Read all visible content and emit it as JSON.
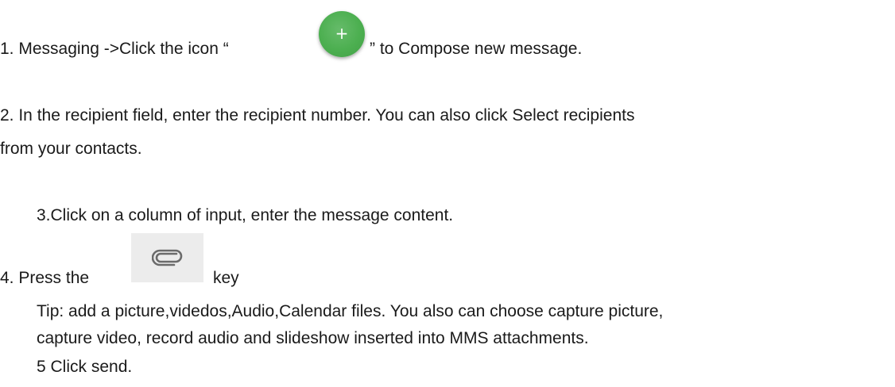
{
  "steps": {
    "step1_before": "1. Messaging ->Click the icon “",
    "step1_icon_glyph": "+",
    "step1_after": "” to Compose new message.",
    "step2_line1": "2. In the recipient field, enter the recipient number. You can also click Select recipients",
    "step2_line2": "from your contacts.",
    "step3": "3.Click on a column of input, enter the message content.",
    "step4_before": "4. Press the",
    "step4_after": "key",
    "tip_line1": "Tip: add a picture,videdos,Audio,Calendar files. You also can choose capture picture,",
    "tip_line2": "capture video, record audio and slideshow inserted into MMS attachments.",
    "step5": "5 Click send."
  },
  "icons": {
    "compose": "add-icon",
    "attach": "paperclip-icon"
  },
  "colors": {
    "fab_green": "#4caf50",
    "key_background": "#ececec",
    "text": "#1a1a1a"
  }
}
